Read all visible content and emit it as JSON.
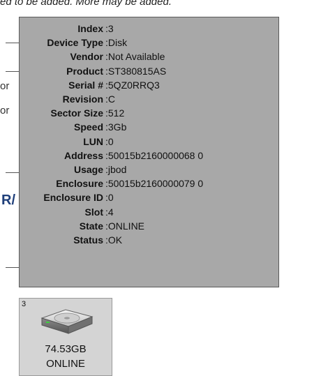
{
  "background": {
    "top_line": "ed to be added. More may be added.",
    "frag_on_1": "or",
    "frag_on_2": "or",
    "frag_heading": "R/"
  },
  "tooltip": {
    "rows": [
      {
        "label": "Index",
        "value": "3"
      },
      {
        "label": "Device Type",
        "value": "Disk"
      },
      {
        "label": "Vendor",
        "value": "Not Available"
      },
      {
        "label": "Product",
        "value": "ST380815AS"
      },
      {
        "label": "Serial #",
        "value": "5QZ0RRQ3"
      },
      {
        "label": "Revision",
        "value": "C"
      },
      {
        "label": "Sector Size",
        "value": "512"
      },
      {
        "label": "Speed",
        "value": "3Gb"
      },
      {
        "label": "LUN",
        "value": "0"
      },
      {
        "label": "Address",
        "value": "50015b2160000068 0"
      },
      {
        "label": "Usage",
        "value": "jbod"
      },
      {
        "label": "Enclosure",
        "value": "50015b2160000079 0"
      },
      {
        "label": "Enclosure ID",
        "value": "0"
      },
      {
        "label": "Slot",
        "value": "4"
      },
      {
        "label": "State",
        "value": "ONLINE"
      },
      {
        "label": "Status",
        "value": "OK"
      }
    ],
    "separator": ":"
  },
  "disk": {
    "index": "3",
    "size": "74.53GB",
    "state": "ONLINE",
    "icon": "hard-drive-icon"
  },
  "colors": {
    "tooltip_bg": "#a8a8a8",
    "tile_bg": "#d4d4d4",
    "heading_blue": "#1f3f7a"
  }
}
